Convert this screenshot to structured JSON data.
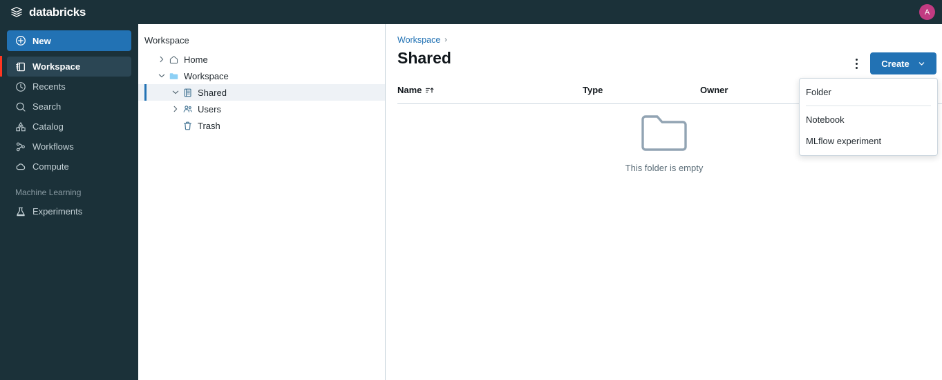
{
  "brand": {
    "name": "databricks",
    "logo_icon": "databricks-stack-icon",
    "accent_blue": "#2272B4",
    "bar_dark": "#1B3139",
    "active_accent": "#FF3621"
  },
  "topbar": {
    "avatar_initial": "A",
    "avatar_color": "#C13B82"
  },
  "sidebar": {
    "new_button": {
      "label": "New",
      "icon": "plus-circle-icon"
    },
    "items": [
      {
        "label": "Workspace",
        "icon": "workspace-icon",
        "active": true
      },
      {
        "label": "Recents",
        "icon": "clock-icon",
        "active": false
      },
      {
        "label": "Search",
        "icon": "search-icon",
        "active": false
      },
      {
        "label": "Catalog",
        "icon": "catalog-icon",
        "active": false
      },
      {
        "label": "Workflows",
        "icon": "workflows-icon",
        "active": false
      },
      {
        "label": "Compute",
        "icon": "cloud-icon",
        "active": false
      }
    ],
    "section_label": "Machine Learning",
    "section_items": [
      {
        "label": "Experiments",
        "icon": "experiments-flask-icon",
        "active": false
      }
    ]
  },
  "tree": {
    "title": "Workspace",
    "nodes": [
      {
        "label": "Home",
        "icon": "home-icon",
        "caret": "right",
        "indent": 1,
        "selected": false
      },
      {
        "label": "Workspace",
        "icon": "folder-icon",
        "caret": "down",
        "indent": 1,
        "selected": false
      },
      {
        "label": "Shared",
        "icon": "notebook-icon",
        "caret": "down",
        "indent": 2,
        "selected": true
      },
      {
        "label": "Users",
        "icon": "users-icon",
        "caret": "right",
        "indent": 2,
        "selected": false
      },
      {
        "label": "Trash",
        "icon": "trash-icon",
        "caret": "none",
        "indent": 2,
        "selected": false
      }
    ]
  },
  "main": {
    "breadcrumb": {
      "link": "Workspace",
      "separator": "›"
    },
    "title": "Shared",
    "kebab_icon": "more-vertical-icon",
    "create_button": {
      "label": "Create",
      "chevron_icon": "chevron-down-icon"
    },
    "columns": [
      {
        "key": "name",
        "label": "Name",
        "sort_icon": "sort-ascending-icon"
      },
      {
        "key": "type",
        "label": "Type",
        "sort_icon": ""
      },
      {
        "key": "owner",
        "label": "Owner",
        "sort_icon": ""
      }
    ],
    "rows": [],
    "empty_state": {
      "icon": "empty-folder-icon",
      "text": "This folder is empty"
    }
  },
  "create_menu": {
    "open": true,
    "items": [
      {
        "label": "Folder",
        "separator_after": true
      },
      {
        "label": "Notebook",
        "separator_after": false
      },
      {
        "label": "MLflow experiment",
        "separator_after": false
      }
    ]
  }
}
